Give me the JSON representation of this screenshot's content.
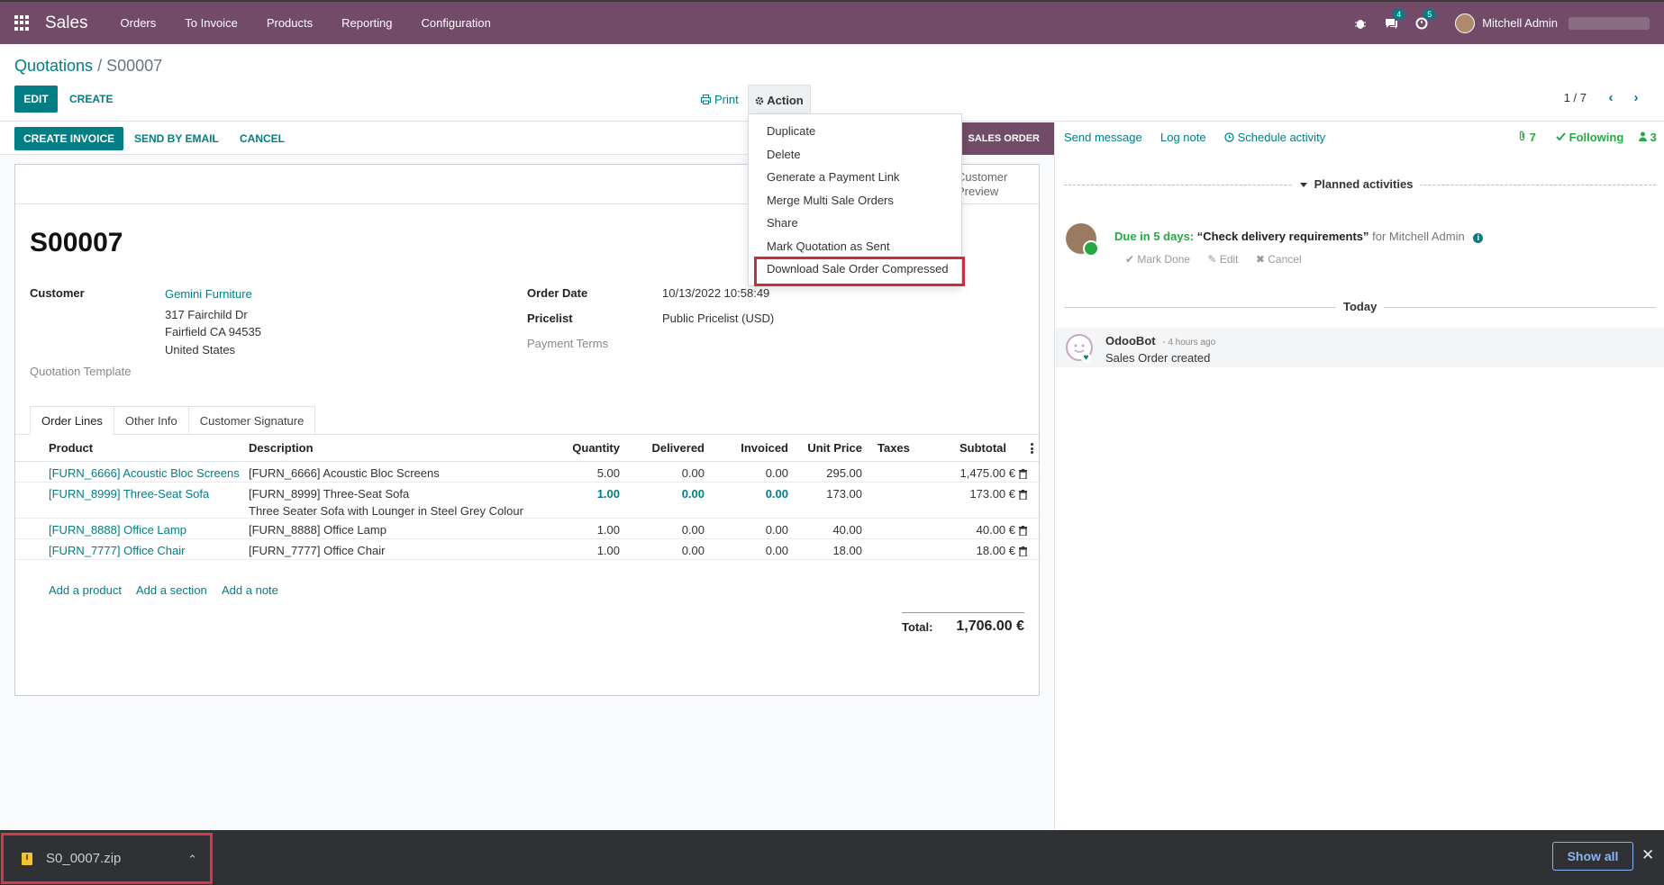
{
  "navbar": {
    "app": "Sales",
    "menu": [
      "Orders",
      "To Invoice",
      "Products",
      "Reporting",
      "Configuration"
    ],
    "messages_count": "4",
    "activities_count": "5",
    "user": "Mitchell Admin"
  },
  "breadcrumb": {
    "parent": "Quotations",
    "separator": " / ",
    "current": "S00007"
  },
  "toolbar": {
    "edit": "EDIT",
    "create": "CREATE",
    "print": "Print",
    "action": "Action"
  },
  "pager": {
    "value": "1 / 7"
  },
  "statusbar": {
    "create_invoice": "CREATE INVOICE",
    "send_by_email": "SEND BY EMAIL",
    "cancel": "CANCEL",
    "stage": "SALES ORDER"
  },
  "action_menu": {
    "items": [
      "Duplicate",
      "Delete",
      "Generate a Payment Link",
      "Merge Multi Sale Orders",
      "Share",
      "Mark Quotation as Sent",
      "Download Sale Order Compressed"
    ]
  },
  "sheet": {
    "smart_button": "Customer Preview",
    "title": "S00007",
    "customer_label": "Customer",
    "customer_name": "Gemini Furniture",
    "customer_address": [
      "317 Fairchild Dr",
      "Fairfield CA 94535",
      "United States"
    ],
    "quotation_template_label": "Quotation Template",
    "order_date_label": "Order Date",
    "order_date": "10/13/2022 10:58:49",
    "pricelist_label": "Pricelist",
    "pricelist": "Public Pricelist (USD)",
    "payment_terms_label": "Payment Terms"
  },
  "tabs": [
    "Order Lines",
    "Other Info",
    "Customer Signature"
  ],
  "order_lines": {
    "columns": [
      "Product",
      "Description",
      "Quantity",
      "Delivered",
      "Invoiced",
      "Unit Price",
      "Taxes",
      "Subtotal"
    ],
    "rows": [
      {
        "product": "[FURN_6666] Acoustic Bloc Screens",
        "description": "[FURN_6666] Acoustic Bloc Screens",
        "description2": "",
        "quantity": "5.00",
        "delivered": "0.00",
        "invoiced": "0.00",
        "unit_price": "295.00",
        "taxes": "",
        "subtotal": "1,475.00 €"
      },
      {
        "product": "[FURN_8999] Three-Seat Sofa",
        "description": "[FURN_8999] Three-Seat Sofa",
        "description2": "Three Seater Sofa with Lounger in Steel Grey Colour",
        "quantity": "1.00",
        "delivered": "0.00",
        "invoiced": "0.00",
        "unit_price": "173.00",
        "taxes": "",
        "subtotal": "173.00 €"
      },
      {
        "product": "[FURN_8888] Office Lamp",
        "description": "[FURN_8888] Office Lamp",
        "description2": "",
        "quantity": "1.00",
        "delivered": "0.00",
        "invoiced": "0.00",
        "unit_price": "40.00",
        "taxes": "",
        "subtotal": "40.00 €"
      },
      {
        "product": "[FURN_7777] Office Chair",
        "description": "[FURN_7777] Office Chair",
        "description2": "",
        "quantity": "1.00",
        "delivered": "0.00",
        "invoiced": "0.00",
        "unit_price": "18.00",
        "taxes": "",
        "subtotal": "18.00 €"
      }
    ],
    "add_product": "Add a product",
    "add_section": "Add a section",
    "add_note": "Add a note",
    "total_label": "Total:",
    "total_value": "1,706.00 €"
  },
  "chatter": {
    "send_message": "Send message",
    "log_note": "Log note",
    "schedule_activity": "Schedule activity",
    "attachments": "7",
    "following": "Following",
    "followers": "3",
    "planned_activities": "Planned activities",
    "activity": {
      "due": "Due in 5 days:",
      "summary": "“Check delivery requirements”",
      "assignee": "for Mitchell Admin",
      "mark_done": "Mark Done",
      "edit": "Edit",
      "cancel": "Cancel"
    },
    "today": "Today",
    "message": {
      "author": "OdooBot",
      "time": "- 4 hours ago",
      "body": "Sales Order created"
    }
  },
  "download_bar": {
    "file": "S0_0007.zip",
    "show_all": "Show all"
  },
  "colors": {
    "brand": "#714b67",
    "accent": "#017e84",
    "highlight": "#c6303e",
    "success": "#28a745"
  }
}
